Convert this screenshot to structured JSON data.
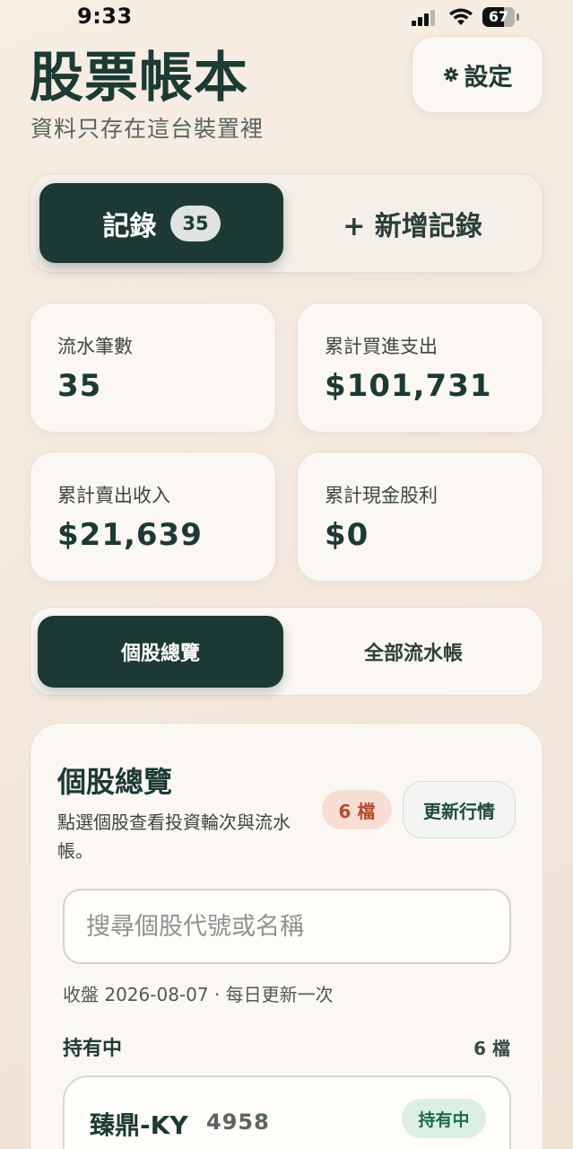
{
  "status_bar": {
    "time": "9:33",
    "battery": "67",
    "battery_level": 0.67
  },
  "header": {
    "title": "股票帳本",
    "subtitle": "資料只存在這台裝置裡",
    "settings_label": "設定"
  },
  "mode_switch": {
    "records_label": "記錄",
    "records_count": "35",
    "add_label": "+ 新增記錄"
  },
  "stats": [
    {
      "label": "流水筆數",
      "value": "35"
    },
    {
      "label": "累計買進支出",
      "value": "$101,731"
    },
    {
      "label": "累計賣出收入",
      "value": "$21,639"
    },
    {
      "label": "累計現金股利",
      "value": "$0"
    }
  ],
  "view_tabs": {
    "active": "個股總覽",
    "other": "全部流水帳"
  },
  "panel": {
    "title": "個股總覽",
    "description": "點選個股查看投資輪次與流水帳。",
    "count_badge": "6 檔",
    "refresh_label": "更新行情",
    "search_placeholder": "搜尋個股代號或名稱",
    "close_info": "收盤 2026-08-07 · 每日更新一次",
    "section_label": "持有中",
    "section_count": "6 檔",
    "stocks": [
      {
        "name": "臻鼎-KY",
        "code": "4958",
        "tag": "持有中"
      }
    ]
  },
  "colors": {
    "primary": "#1c3a33",
    "badge_bg": "#f7ded4",
    "badge_text": "#b54a2a",
    "tag_bg": "#dcefe4",
    "tag_text": "#1f6a4a"
  },
  "icons": {
    "settings": "gear-icon",
    "signal": "cellular-signal-icon",
    "wifi": "wifi-icon",
    "battery": "battery-icon"
  }
}
